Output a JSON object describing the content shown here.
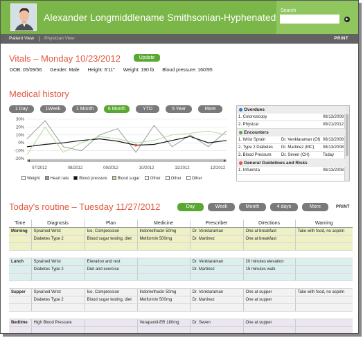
{
  "header": {
    "patient_name": "Alexander Longmiddlename Smithsonian-Hyphenated",
    "search_label": "Search",
    "search_value": ""
  },
  "tabs": {
    "patient_view": "Patient View",
    "physician_view": "Physician View",
    "print": "PRINT"
  },
  "vitals": {
    "title": "Vitals – Monday 10/23/2012",
    "update_label": "Update",
    "dob": "DOB: 05/09/56",
    "gender": "Gender: Male",
    "height": "Height: 6'11\"",
    "weight": "Weight: 190 lb",
    "blood_pressure": "Blood pressure: 160/95"
  },
  "medical_history": {
    "title": "Medical history",
    "ranges": [
      "1 Day",
      "1Week",
      "1 Month",
      "6 Month",
      "YTD",
      "5 Year",
      "More"
    ],
    "active_range": "6 Month"
  },
  "chart_data": {
    "type": "line",
    "x": [
      "07/2012",
      "08/2012",
      "09/2012",
      "10/2012",
      "11/2012",
      "12/2012"
    ],
    "y_ticks": [
      "30%",
      "20%",
      "10%",
      "0%",
      "-10%",
      "-20%"
    ],
    "ylim": [
      -20,
      30
    ],
    "series": [
      {
        "name": "Weight",
        "color": "#ffffff",
        "values": []
      },
      {
        "name": "Heart rate",
        "color": "#9a9a9a",
        "values": [
          5,
          28,
          -5,
          -10,
          10,
          18,
          -12,
          22,
          -5,
          10,
          -5,
          15
        ]
      },
      {
        "name": "Blood pressure",
        "color": "#111111",
        "values": [
          -5,
          -2,
          0,
          3,
          5,
          2,
          -3,
          -2,
          3,
          8,
          0,
          3
        ]
      },
      {
        "name": "Blood sugar",
        "color": "#b5d99a",
        "values": [
          -15,
          20,
          -12,
          0,
          8,
          5,
          0,
          3,
          10,
          12,
          15,
          10
        ]
      },
      {
        "name": "Other",
        "color": "#ffffff",
        "values": []
      },
      {
        "name": "Other",
        "color": "#ffffff",
        "values": []
      },
      {
        "name": "Other",
        "color": "#ffffff",
        "values": []
      }
    ]
  },
  "side_panel": {
    "overdues": {
      "title": "Overdues",
      "color": "#2a7ac4",
      "rows": [
        [
          "1. Colonoscopy",
          "",
          "08/13/2008"
        ],
        [
          "2. Physical",
          "",
          "09/21/2012"
        ]
      ]
    },
    "encounters": {
      "title": "Encounters",
      "color": "#5aa832",
      "rows": [
        [
          "1. Wrist Sprain",
          "Dr. Venklaraman (Of)",
          "08/13/2008"
        ],
        [
          "2. Type 2 Diabetes",
          "Dr. Martinez (MC)",
          "08/13/2008"
        ],
        [
          "3. Blood Pressure",
          "Dr. Seven (CH)",
          "Today"
        ]
      ]
    },
    "guidelines": {
      "title": "General Guidelines and Risks",
      "color": "#e2583e",
      "rows": [
        [
          "1. Influenza",
          "",
          "08/13/2008"
        ]
      ]
    }
  },
  "routine": {
    "title": "Today's routine – Tuesday 11/27/2012",
    "ranges": [
      "Day",
      "Week",
      "Month",
      "4 days",
      "More"
    ],
    "active_range": "Day",
    "print": "PRINT",
    "columns": [
      "Time",
      "Diagnosis",
      "Plan",
      "Medicine",
      "Prescriber",
      "Directions",
      "Warning"
    ],
    "groups": [
      {
        "cls": "g-morning",
        "rows": [
          [
            "Morning",
            "Sprained Wrist",
            "Ice, Compression",
            "Indomethacin 50mg",
            "Dr. Venktaraman",
            "One at breakfast",
            "Take with food, no aspirin"
          ],
          [
            "",
            "Diabetes Type 2",
            "Blood sugar testing, diet",
            "Metformin 500mg",
            "Dr. Martinez",
            "One at breakfast",
            ""
          ],
          [
            "",
            "",
            "",
            "",
            "",
            "",
            ""
          ]
        ]
      },
      {
        "cls": "g-lunch",
        "rows": [
          [
            "Lunch",
            "Sprained Wrist",
            "Elevation and rest",
            "",
            "Dr. Venktaraman",
            "20 minutes elevation",
            ""
          ],
          [
            "",
            "Diabetes Type 2",
            "Diet and exercise",
            "",
            "Dr. Martinez",
            "15 minutes walk",
            ""
          ],
          [
            "",
            "",
            "",
            "",
            "",
            "",
            ""
          ]
        ]
      },
      {
        "cls": "g-supper",
        "rows": [
          [
            "Supper",
            "Sprained Wrist",
            "Ice, Compression",
            "Indomethacin 50mg",
            "Dr. Venktaraman",
            "One at supper",
            "Take with food, no aspirin"
          ],
          [
            "",
            "Diabetes Type 2",
            "Blood sugar testing, diet",
            "Metformin 500mg",
            "Dr. Martinez",
            "One at supper",
            ""
          ],
          [
            "",
            "",
            "",
            "",
            "",
            "",
            ""
          ]
        ]
      },
      {
        "cls": "g-bedtime",
        "rows": [
          [
            "Bedtime",
            "High Blood Pressure",
            "",
            "Verapamil-ER 180mg",
            "Dr. Seven",
            "One at supper",
            ""
          ],
          [
            "",
            "",
            "",
            "",
            "",
            "",
            ""
          ],
          [
            "",
            "",
            "",
            "",
            "",
            "",
            ""
          ],
          [
            "",
            "",
            "",
            "",
            "",
            "",
            ""
          ]
        ]
      }
    ]
  }
}
